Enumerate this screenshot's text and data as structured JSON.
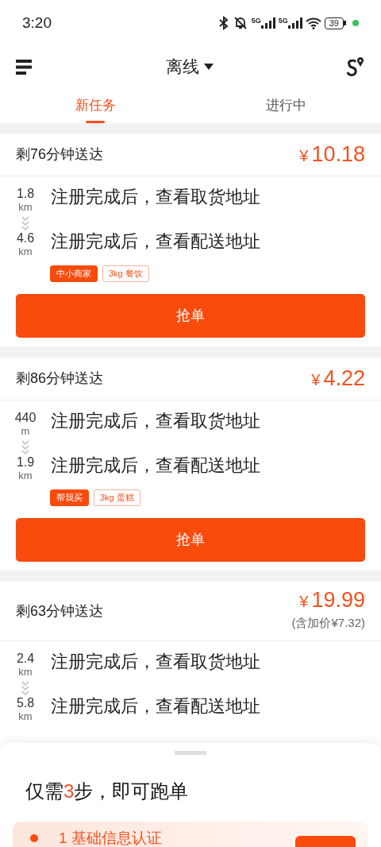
{
  "status_bar": {
    "time": "3:20",
    "network_labels": [
      "5G",
      "5G"
    ],
    "battery": "39"
  },
  "header": {
    "title": "离线"
  },
  "tabs": [
    {
      "label": "新任务",
      "selected": true
    },
    {
      "label": "进行中",
      "selected": false
    }
  ],
  "orders": [
    {
      "time_left": "剩76分钟送达",
      "price": "10.18",
      "currency": "¥",
      "pickup": {
        "distance": "1.8",
        "unit": "km",
        "address": "注册完成后，查看取货地址"
      },
      "dropoff": {
        "distance": "4.6",
        "unit": "km",
        "address": "注册完成后，查看配送地址"
      },
      "tags": [
        {
          "label": "中小商家",
          "kind": "filled"
        },
        {
          "label": "3kg 餐饮",
          "kind": "outline"
        }
      ],
      "button": "抢单"
    },
    {
      "time_left": "剩86分钟送达",
      "price": "4.22",
      "currency": "¥",
      "pickup": {
        "distance": "440",
        "unit": "m",
        "address": "注册完成后，查看取货地址"
      },
      "dropoff": {
        "distance": "1.9",
        "unit": "km",
        "address": "注册完成后，查看配送地址"
      },
      "tags": [
        {
          "label": "帮我买",
          "kind": "filled"
        },
        {
          "label": "3kg 蛋糕",
          "kind": "outline"
        }
      ],
      "button": "抢单"
    },
    {
      "time_left": "剩63分钟送达",
      "price": "19.99",
      "currency": "¥",
      "surcharge": "(含加价¥7.32)",
      "pickup": {
        "distance": "2.4",
        "unit": "km",
        "address": "注册完成后，查看取货地址"
      },
      "dropoff": {
        "distance": "5.8",
        "unit": "km",
        "address": "注册完成后，查看配送地址"
      }
    }
  ],
  "sheet": {
    "title": [
      {
        "text": "仅需",
        "highlight": false
      },
      {
        "text": "3",
        "highlight": true
      },
      {
        "text": "步，即可跑单",
        "highlight": false
      }
    ],
    "steps": [
      {
        "label": "1 基础信息认证"
      }
    ]
  }
}
